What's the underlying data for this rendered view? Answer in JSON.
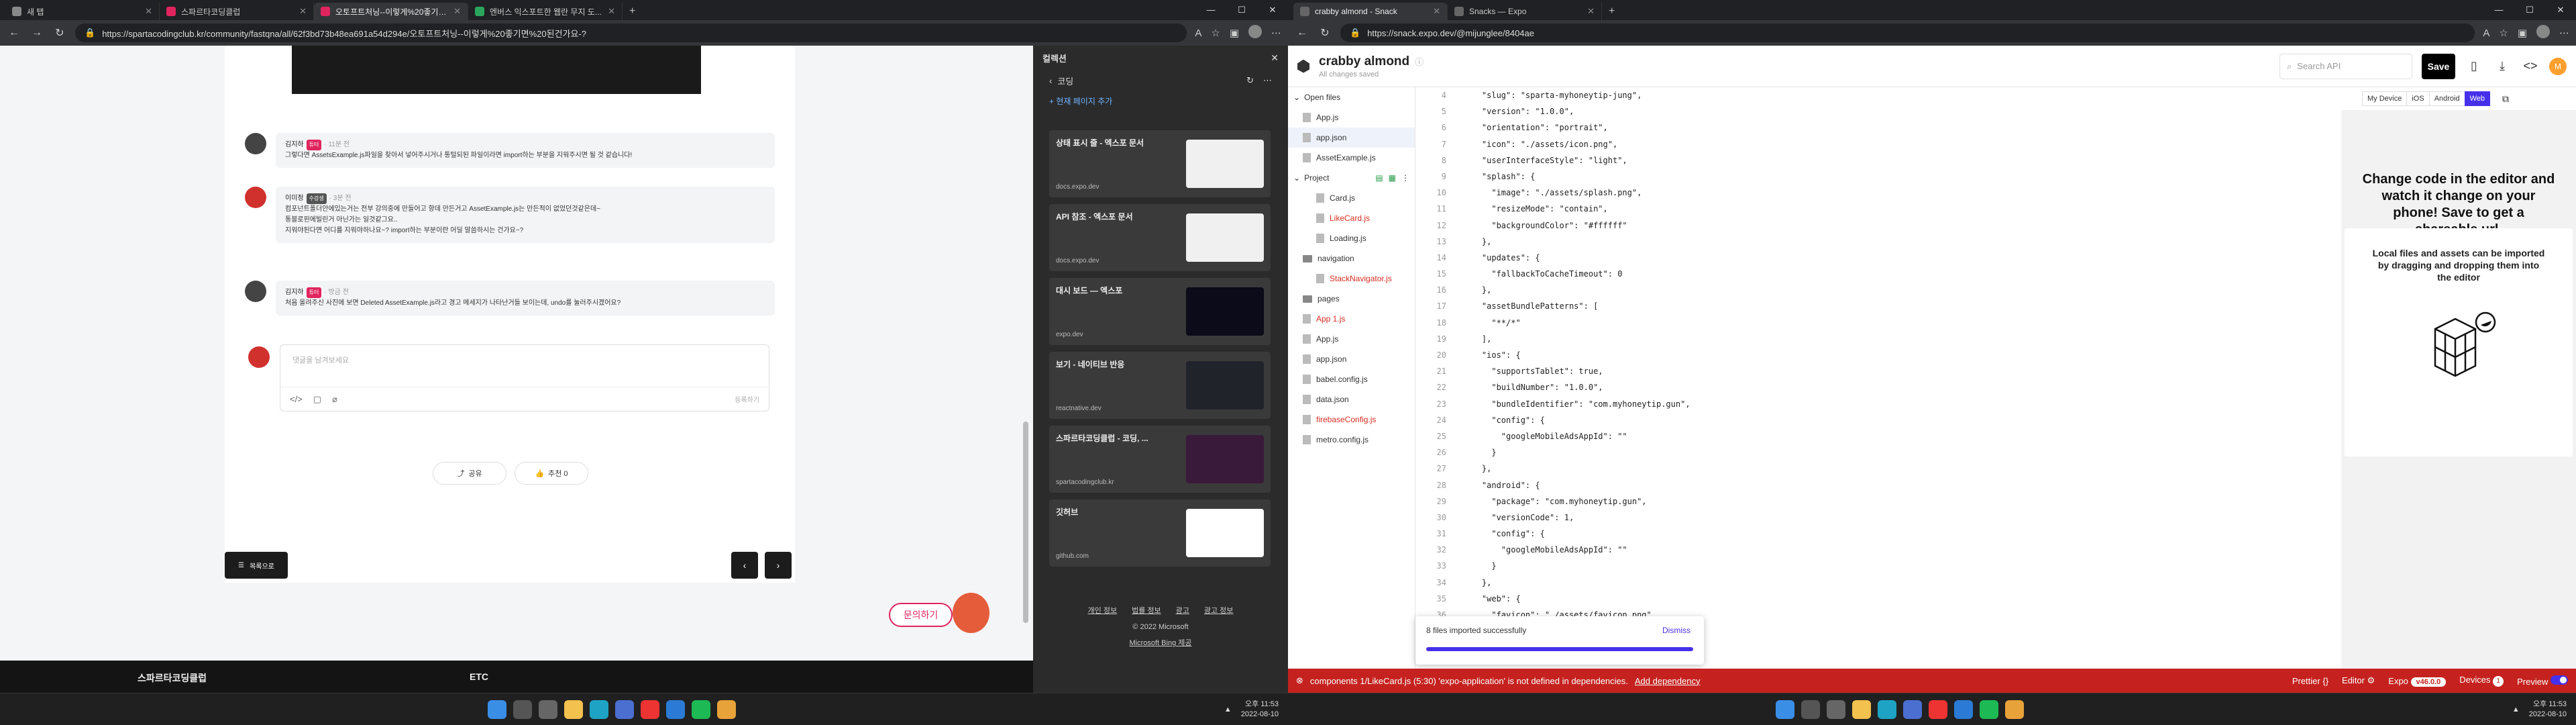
{
  "left": {
    "tabs": [
      {
        "label": "새 탭",
        "color": "#888"
      },
      {
        "label": "스파르타코딩클럽",
        "color": "#e0245e"
      },
      {
        "label": "오토프트처닝--이렇게%20좋기면 ...",
        "color": "#e0245e"
      },
      {
        "label": "엔버스 익스포트한 웹란 무지 도...",
        "color": "#2aa55c"
      }
    ],
    "url": "https://spartacodingclub.kr/community/fastqna/all/62f3bd73b48ea691a54d294e/오토프트처닝--이렇게%20좋기면%20된건가요-?",
    "comments": [
      {
        "name": "김지하",
        "badge": "튜터",
        "meta": "· 11분 전",
        "text": "그렇다면 AssetsExample.js파일을 찾아서 넣어주시거나 통털되된 파일이라면 import하는 부분을 지워주시면 될 것 같습니다!"
      },
      {
        "name": "이미정",
        "badge": "수강생",
        "meta": "· 3분 전",
        "lines": [
          "컴포넌트폴더안에있는거는 전부 강의중에 만들어고 항데 만든거고 AssetExample.js는 만든적이 없었던것같은데~",
          "통블로핀에빌린거 아닌가는 일것같그요..",
          "지워야된다면 어디를 지워야하나요~? import하는 부분이란 어딜 말씀하시는 건가요~?"
        ]
      },
      {
        "name": "김지하",
        "badge": "튜터",
        "meta": "· 방금 전",
        "text": "처음 올려주신 사진에 보면 Deleted AssetExample.js라고 경고 메세지가 나타난거들 보이는데, undo를 눌러주시겠어요?"
      }
    ],
    "input_placeholder": "댓글을 남겨보세요",
    "submit_label": "등록하기",
    "share_label": "공유",
    "recommend_label": "추천 0",
    "list_label": "목록으로",
    "ask_label": "문의하기",
    "footer_brand": "스파르타코딩클럽",
    "footer_etc": "ETC",
    "collections": {
      "title": "컬렉션",
      "folder": "코딩",
      "add_page": "+ 현재 페이지 추가",
      "items": [
        {
          "title": "상태 표시 줄 - 엑스포 문서",
          "domain": "docs.expo.dev",
          "thumb": "#f0f0f0"
        },
        {
          "title": "API 참조 - 엑스포 문서",
          "domain": "docs.expo.dev",
          "thumb": "#f0f0f0"
        },
        {
          "title": "대시 보드 — 엑스포",
          "domain": "expo.dev",
          "thumb": "#0b0b1a"
        },
        {
          "title": "보기 - 네이티브 반응",
          "domain": "reactnative.dev",
          "thumb": "#20232a"
        },
        {
          "title": "스파르타코딩클럽 - 코딩, ...",
          "domain": "spartacodingclub.kr",
          "thumb": "#3a1a3a"
        },
        {
          "title": "깃허브",
          "domain": "github.com",
          "thumb": "#ffffff"
        }
      ],
      "footer_links": [
        "개인 정보",
        "법률 정보",
        "광고",
        "광고 정보"
      ],
      "copyright": "© 2022 Microsoft",
      "bing": "Microsoft Bing 제공"
    },
    "clock_time": "오후 11:53",
    "clock_date": "2022-08-10"
  },
  "right": {
    "tabs": [
      {
        "label": "crabby almond - Snack",
        "color": "#555"
      },
      {
        "label": "Snacks — Expo",
        "color": "#555"
      }
    ],
    "url": "https://snack.expo.dev/@mijunglee/8404ae",
    "project_title": "crabby almond",
    "saved_text": "All changes saved",
    "search_placeholder": "Search API",
    "save_label": "Save",
    "user_initial": "M",
    "open_files_label": "Open files",
    "open_files": [
      "App.js",
      "app.json",
      "AssetExample.js"
    ],
    "project_label": "Project",
    "project_files": [
      {
        "name": "Card.js",
        "ind": true,
        "err": false,
        "type": "file"
      },
      {
        "name": "LikeCard.js",
        "ind": true,
        "err": true,
        "type": "file"
      },
      {
        "name": "Loading.js",
        "ind": true,
        "err": false,
        "type": "file"
      },
      {
        "name": "navigation",
        "ind": false,
        "err": false,
        "type": "folder"
      },
      {
        "name": "StackNavigator.js",
        "ind": true,
        "err": true,
        "type": "file"
      },
      {
        "name": "pages",
        "ind": false,
        "err": false,
        "type": "folder"
      },
      {
        "name": "App 1.js",
        "ind": false,
        "err": true,
        "type": "file"
      },
      {
        "name": "App.js",
        "ind": false,
        "err": false,
        "type": "file"
      },
      {
        "name": "app.json",
        "ind": false,
        "err": false,
        "type": "file"
      },
      {
        "name": "babel.config.js",
        "ind": false,
        "err": false,
        "type": "file"
      },
      {
        "name": "data.json",
        "ind": false,
        "err": false,
        "type": "file"
      },
      {
        "name": "firebaseConfig.js",
        "ind": false,
        "err": true,
        "type": "file"
      },
      {
        "name": "metro.config.js",
        "ind": false,
        "err": false,
        "type": "file"
      }
    ],
    "code_lines": [
      {
        "n": "4",
        "t": "    \"slug\": \"sparta-myhoneytip-jung\","
      },
      {
        "n": "5",
        "t": "    \"version\": \"1.0.0\","
      },
      {
        "n": "6",
        "t": "    \"orientation\": \"portrait\","
      },
      {
        "n": "7",
        "t": "    \"icon\": \"./assets/icon.png\","
      },
      {
        "n": "8",
        "t": "    \"userInterfaceStyle\": \"light\","
      },
      {
        "n": "9",
        "t": "    \"splash\": {"
      },
      {
        "n": "10",
        "t": "      \"image\": \"./assets/splash.png\","
      },
      {
        "n": "11",
        "t": "      \"resizeMode\": \"contain\","
      },
      {
        "n": "12",
        "t": "      \"backgroundColor\": \"#ffffff\""
      },
      {
        "n": "13",
        "t": "    },"
      },
      {
        "n": "14",
        "t": "    \"updates\": {"
      },
      {
        "n": "15",
        "t": "      \"fallbackToCacheTimeout\": 0"
      },
      {
        "n": "16",
        "t": "    },"
      },
      {
        "n": "17",
        "t": "    \"assetBundlePatterns\": ["
      },
      {
        "n": "18",
        "t": "      \"**/*\""
      },
      {
        "n": "19",
        "t": "    ],"
      },
      {
        "n": "20",
        "t": "    \"ios\": {"
      },
      {
        "n": "21",
        "t": "      \"supportsTablet\": true,"
      },
      {
        "n": "22",
        "t": "      \"buildNumber\": \"1.0.0\","
      },
      {
        "n": "23",
        "t": "      \"bundleIdentifier\": \"com.myhoneytip.gun\","
      },
      {
        "n": "24",
        "t": "      \"config\": {"
      },
      {
        "n": "25",
        "t": "        \"googleMobileAdsAppId\": \"\""
      },
      {
        "n": "26",
        "t": "      }"
      },
      {
        "n": "27",
        "t": "    },"
      },
      {
        "n": "28",
        "t": "    \"android\": {"
      },
      {
        "n": "29",
        "t": "      \"package\": \"com.myhoneytip.gun\","
      },
      {
        "n": "30",
        "t": "      \"versionCode\": 1,"
      },
      {
        "n": "31",
        "t": "      \"config\": {"
      },
      {
        "n": "32",
        "t": "        \"googleMobileAdsAppId\": \"\""
      },
      {
        "n": "33",
        "t": "      }"
      },
      {
        "n": "34",
        "t": "    },"
      },
      {
        "n": "35",
        "t": "    \"web\": {"
      },
      {
        "n": "36",
        "t": "      \"favicon\": \"./assets/favicon.png\""
      },
      {
        "n": "37",
        "t": "    }"
      }
    ],
    "toast_message": "8 files imported successfully",
    "toast_dismiss": "Dismiss",
    "preview_tabs": [
      "My Device",
      "iOS",
      "Android",
      "Web"
    ],
    "preview_message": "Change code in the editor and watch it change on your phone! Save to get a shareable url.",
    "preview_card_text": "Local files and assets can be imported by dragging and dropping them into the editor",
    "status_error": "components 1/LikeCard.js (5:30) 'expo-application' is not defined in dependencies.",
    "status_add": "Add dependency",
    "status_prettier": "Prettier",
    "status_editor": "Editor",
    "status_expo": "Expo",
    "status_version": "v46.0.0",
    "status_devices": "Devices",
    "status_devices_count": "1",
    "status_preview": "Preview",
    "clock_time": "오후 11:53",
    "clock_date": "2022-08-10"
  }
}
